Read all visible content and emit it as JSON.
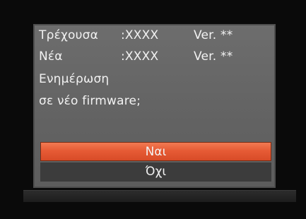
{
  "dialog": {
    "current_label": "Τρέχουσα",
    "current_value": ":XXXX",
    "current_version": "Ver. **",
    "new_label": "Νέα",
    "new_value": ":XXXX",
    "new_version": "Ver. **",
    "question_line1": "Ενημέρωση",
    "question_line2": "σε νέο firmware;"
  },
  "options": {
    "yes_label": "Ναι",
    "no_label": "Όχι"
  },
  "colors": {
    "selected_option": "#e65b35",
    "panel": "#666666",
    "unselected_option": "#3c3c3c"
  }
}
